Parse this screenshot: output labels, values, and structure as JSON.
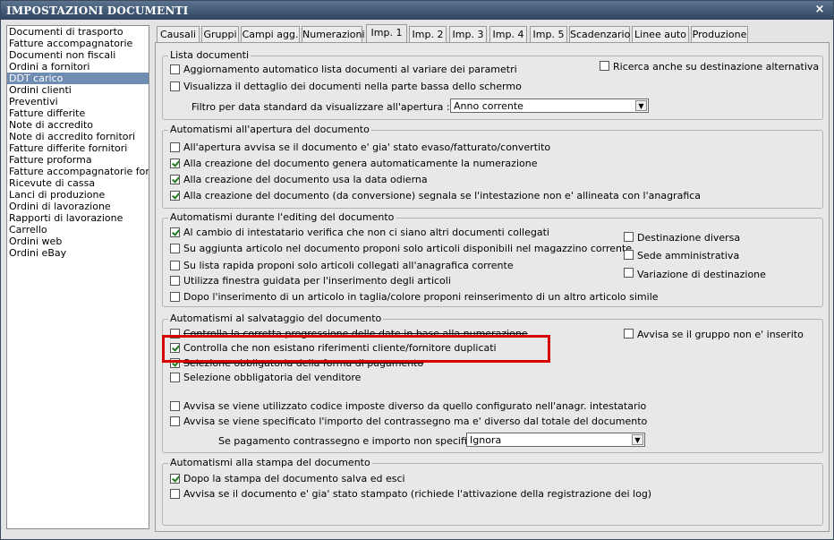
{
  "window": {
    "title": "IMPOSTAZIONI DOCUMENTI",
    "close_glyph": "×"
  },
  "doclist": [
    "Documenti di trasporto",
    "Fatture accompagnatorie",
    "Documenti non fiscali",
    "Ordini a fornitori",
    "DDT carico",
    "Ordini clienti",
    "Preventivi",
    "Fatture differite",
    "Note di accredito",
    "Note di accredito fornitori",
    "Fatture differite fornitori",
    "Fatture proforma",
    "Fatture accompagnatorie fornito",
    "Ricevute di cassa",
    "Lanci di produzione",
    "Ordini di lavorazione",
    "Rapporti di lavorazione",
    "Carrello",
    "Ordini web",
    "Ordini eBay"
  ],
  "selected_doc": "DDT carico",
  "tabs": [
    "Causali",
    "Gruppi",
    "Campi agg.",
    "Numerazioni",
    "Imp. 1",
    "Imp. 2",
    "Imp. 3",
    "Imp. 4",
    "Imp. 5",
    "Scadenzario",
    "Linee auto",
    "Produzione"
  ],
  "active_tab": "Imp. 1",
  "lista": {
    "title": "Lista documenti",
    "cb1": "Aggiornamento automatico lista documenti al variare dei parametri",
    "cb2": "Visualizza il dettaglio dei documenti nella parte bassa dello schermo",
    "cb3": "Ricerca anche su destinazione alternativa",
    "filter_label": "Filtro per data standard da visualizzare all'apertura :",
    "filter_value": "Anno corrente"
  },
  "apertura": {
    "title": "Automatismi all'apertura del documento",
    "cb1": "All'apertura avvisa se il documento e' gia' stato evaso/fatturato/convertito",
    "cb2": "Alla creazione del documento genera automaticamente la numerazione",
    "cb3": "Alla creazione del documento usa la data odierna",
    "cb4": "Alla creazione del documento (da conversione) segnala se l'intestazione non e' allineata con l'anagrafica"
  },
  "editing": {
    "title": "Automatismi durante l'editing del documento",
    "cb1": "Al cambio di intestatario verifica che non ci siano altri documenti collegati",
    "cb2": "Su aggiunta articolo nel documento proponi solo articoli disponibili nel magazzino corrente",
    "cb3": "Su lista rapida proponi solo articoli collegati all'anagrafica corrente",
    "cb4": "Utilizza finestra guidata per l'inserimento degli articoli",
    "cb5": "Dopo l'inserimento di un articolo in taglia/colore proponi reinserimento di un altro articolo simile",
    "r1": "Destinazione diversa",
    "r2": "Sede amministrativa",
    "r3": "Variazione di destinazione"
  },
  "salvataggio": {
    "title": "Automatismi al salvataggio del documento",
    "cb1": "Controlla la corretta progressione delle date in base alla numerazione",
    "cb2": "Controlla che non esistano riferimenti cliente/fornitore duplicati",
    "cb3": "Selezione obbligatoria della forma di pagamento",
    "cb4": "Selezione obbligatoria del venditore",
    "cb5": "Avvisa se viene utilizzato codice imposte diverso da quello configurato nell'anagr. intestatario",
    "cb6": "Avvisa se viene specificato l'importo del contrassegno ma e' diverso dal totale del documento",
    "r1": "Avvisa se il gruppo non e' inserito",
    "pay_label": "Se pagamento contrassegno e importo non specificato :",
    "pay_value": "Ignora"
  },
  "stampa": {
    "title": "Automatismi alla stampa del documento",
    "cb1": "Dopo la stampa del documento salva ed esci",
    "cb2": "Avvisa se il documento e' gia' stato stampato (richiede l'attivazione della registrazione dei log)"
  },
  "dropdown_arrow": "▼",
  "colors": {
    "accent": "#6f8db3",
    "highlight": "#d60000",
    "check": "#1f7a1f"
  }
}
